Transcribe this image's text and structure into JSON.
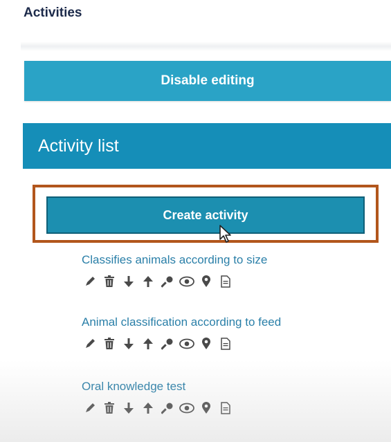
{
  "page": {
    "title": "Activities"
  },
  "editing": {
    "disable_label": "Disable editing"
  },
  "activity_list": {
    "header": "Activity list",
    "create_label": "Create activity",
    "items": [
      {
        "name": "Classifies animals according to size"
      },
      {
        "name": "Animal classification according to feed"
      },
      {
        "name": "Oral knowledge test"
      }
    ],
    "item_icons": [
      "edit-icon",
      "trash-icon",
      "move-down-icon",
      "move-up-icon",
      "key-icon",
      "eye-icon",
      "map-pin-icon",
      "document-icon"
    ]
  },
  "colors": {
    "disable_button": "#2aa3c6",
    "list_header": "#158eb8",
    "create_button": "#1c8fb0",
    "highlight_border": "#b2561c",
    "link": "#2a7fa8",
    "icon": "#4a4a4a"
  }
}
